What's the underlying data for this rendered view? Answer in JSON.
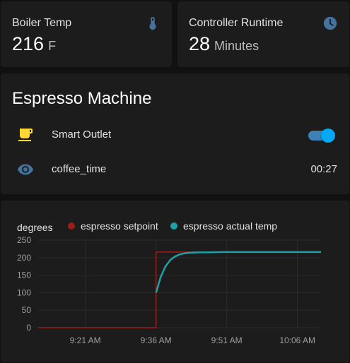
{
  "boiler": {
    "name": "Boiler Temp",
    "value": "216",
    "unit": "F",
    "icon": "thermometer-icon"
  },
  "runtime": {
    "name": "Controller Runtime",
    "value": "28",
    "unit": "Minutes",
    "icon": "clock-icon"
  },
  "espresso": {
    "title": "Espresso Machine",
    "entities": [
      {
        "label": "Smart Outlet",
        "icon": "coffee-icon",
        "state": "on"
      },
      {
        "label": "coffee_time",
        "icon": "eye-icon",
        "state": "00:27"
      }
    ]
  },
  "colors": {
    "accent": "#03a9f4",
    "setpoint": "#9b1c1c",
    "actual": "#1ea0a6",
    "icon_blue": "#44739e",
    "icon_yellow": "#fdd835"
  },
  "chart_data": {
    "type": "line",
    "ylabel": "degrees",
    "yticks": [
      0,
      50,
      100,
      150,
      200,
      250
    ],
    "ylim": [
      0,
      250
    ],
    "xticks": [
      "9:21 AM",
      "9:36 AM",
      "9:51 AM",
      "10:06 AM"
    ],
    "xlim_minutes_after_9": [
      11,
      71
    ],
    "legend": [
      "espresso setpoint",
      "espresso actual temp"
    ],
    "legend_position": "top",
    "series": [
      {
        "name": "espresso setpoint",
        "x_minutes_after_9": [
          11,
          36,
          36,
          71
        ],
        "values": [
          0,
          0,
          216,
          216
        ]
      },
      {
        "name": "espresso actual temp",
        "x_minutes_after_9": [
          36,
          37,
          38,
          39,
          40,
          41,
          42,
          43,
          45,
          47,
          50,
          55,
          60,
          65,
          71
        ],
        "values": [
          100,
          145,
          175,
          193,
          203,
          209,
          212,
          214,
          215,
          215,
          216,
          216,
          216,
          216,
          216
        ]
      }
    ]
  }
}
